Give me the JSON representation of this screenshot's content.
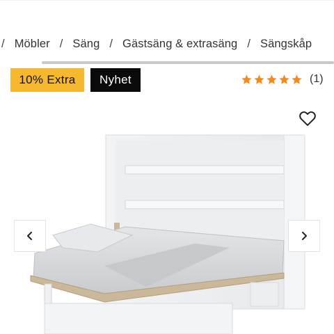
{
  "breadcrumb": {
    "separator": "/",
    "items": [
      {
        "label": "Möbler"
      },
      {
        "label": "Säng"
      },
      {
        "label": "Gästsäng & extrasäng"
      },
      {
        "label": "Sängskåp"
      }
    ]
  },
  "badges": {
    "discount": "10% Extra",
    "new": "Nyhet"
  },
  "rating": {
    "stars": 5,
    "max_stars": 5,
    "count_label": "(1)",
    "star_color": "#f08a1c"
  },
  "colors": {
    "discount_badge": "#f5b82e",
    "new_badge": "#0a0a0a"
  },
  "icons": {
    "favorite": "heart-outline-icon",
    "prev": "chevron-left-icon",
    "next": "chevron-right-icon",
    "rating": "star-icon"
  }
}
